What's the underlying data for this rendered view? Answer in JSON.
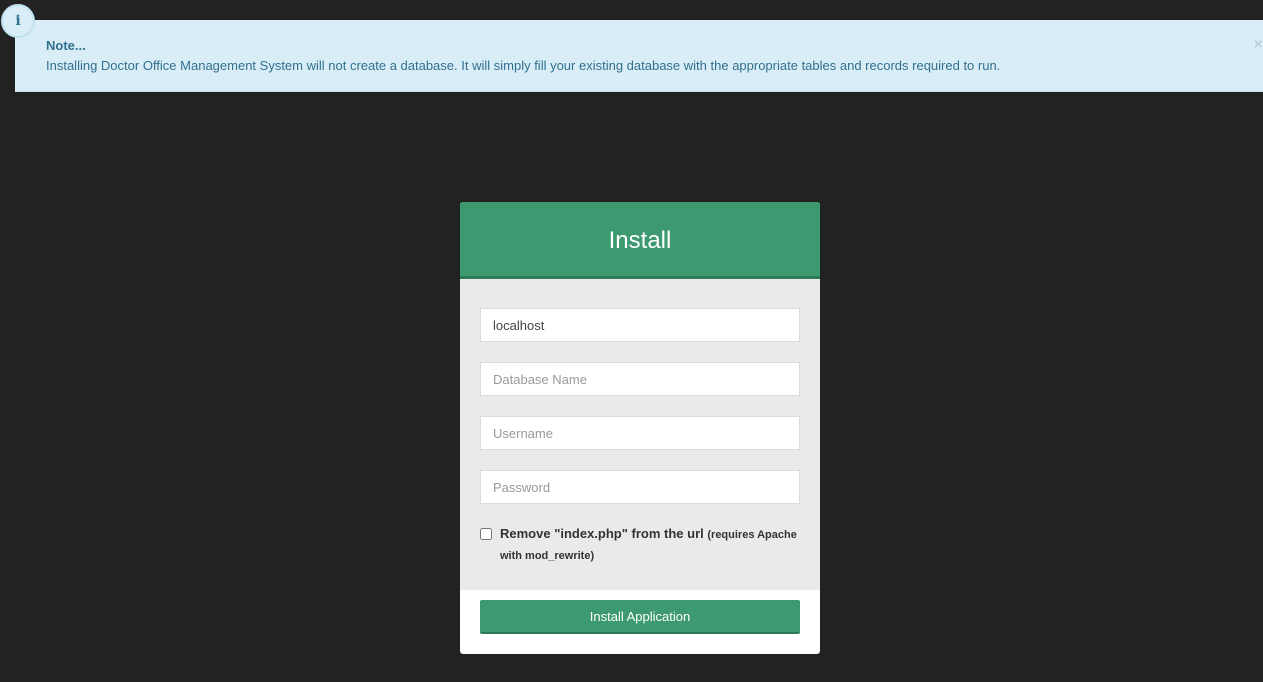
{
  "alert": {
    "icon": "info-icon",
    "icon_glyph": "i",
    "title": "Note...",
    "text": "Installing Doctor Office Management System will not create a database. It will simply fill your existing database with the appropriate tables and records required to run.",
    "close_glyph": "×"
  },
  "install": {
    "title": "Install",
    "host": {
      "value": "localhost",
      "placeholder": ""
    },
    "db_name": {
      "value": "",
      "placeholder": "Database Name"
    },
    "username": {
      "value": "",
      "placeholder": "Username"
    },
    "password": {
      "value": "",
      "placeholder": "Password"
    },
    "rewrite": {
      "checked": false,
      "label": "Remove \"index.php\" from the url",
      "note": "(requires Apache with mod_rewrite)"
    },
    "submit_label": "Install Application"
  },
  "colors": {
    "background": "#222222",
    "alert_bg": "#d9edf7",
    "alert_text": "#31708f",
    "accent": "#3d9970",
    "panel_body": "#eaeaec"
  }
}
